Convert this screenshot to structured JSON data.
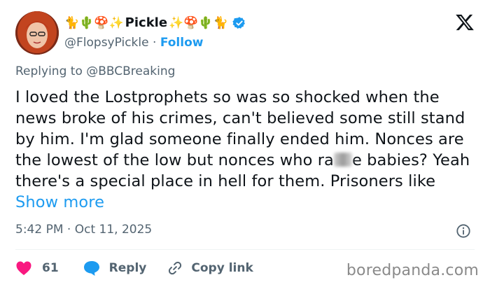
{
  "author": {
    "display_name": "Pickle",
    "emoji_left": "🐈🌵🍄✨",
    "emoji_right": "✨🍄🌵🐈",
    "handle": "@FlopsyPickle",
    "separator": "·",
    "follow_label": "Follow",
    "verified": true
  },
  "reply_context": {
    "prefix": "Replying to",
    "mention": "@BBCBreaking"
  },
  "tweet": {
    "text_part1": "I loved the Lostprophets so was so shocked when the news broke of his crimes, can't believed some still stand by him. I'm glad someone finally ended him. Nonces are the lowest of the low but nonces who ra",
    "text_part2": "e babies? Yeah there's a special place in hell for them. Prisoners like ",
    "show_more": "Show more"
  },
  "meta": {
    "time": "5:42 PM",
    "separator": "·",
    "date": "Oct 11, 2025"
  },
  "actions": {
    "like_count": "61",
    "reply_label": "Reply",
    "copy_link_label": "Copy link"
  },
  "watermark": "boredpanda.com",
  "colors": {
    "accent": "#1d9bf0",
    "heart": "#f91880",
    "muted": "#536471",
    "text": "#0f1419"
  }
}
